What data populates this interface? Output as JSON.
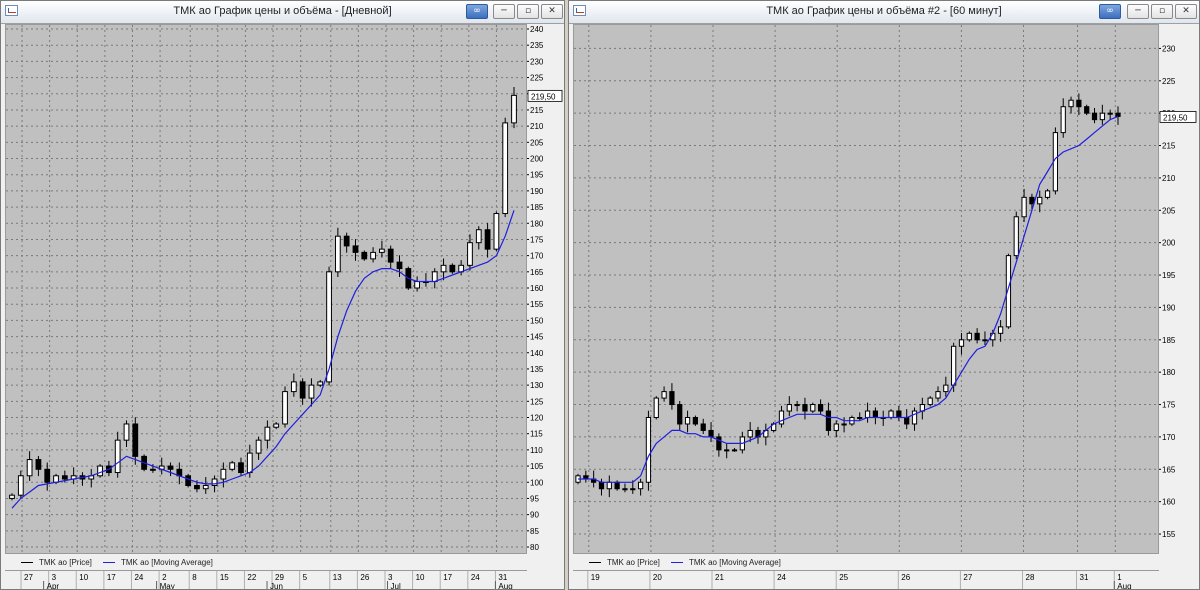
{
  "windows": [
    {
      "title": "ТМК ао График цены и объёма - [Дневной]",
      "legend": [
        {
          "label": "TMK ao [Price]",
          "color": "#000000"
        },
        {
          "label": "TMK ao [Moving Average]",
          "color": "#1f1fe0"
        }
      ],
      "y_ticks": [
        240,
        235,
        230,
        225,
        220,
        215,
        210,
        205,
        200,
        195,
        190,
        185,
        180,
        175,
        170,
        165,
        160,
        155,
        150,
        145,
        140,
        135,
        130,
        125,
        120,
        115,
        110,
        105,
        100,
        95,
        90,
        85,
        80
      ],
      "last_price": "219,50",
      "x_day_labels": [
        "27",
        "3",
        "10",
        "17",
        "24",
        "2",
        "8",
        "15",
        "22",
        "29",
        "5",
        "13",
        "26",
        "3",
        "10",
        "17",
        "24",
        "31"
      ],
      "x_month_labels": [
        "Apr",
        "May",
        "Jun",
        "Jul",
        "Aug"
      ]
    },
    {
      "title": "ТМК ао График цены и объёма #2 - [60 минут]",
      "legend": [
        {
          "label": "TMK ao [Price]",
          "color": "#000000"
        },
        {
          "label": "TMK ao [Moving Average]",
          "color": "#1f1fe0"
        }
      ],
      "y_ticks": [
        230,
        225,
        220,
        215,
        210,
        205,
        200,
        195,
        190,
        185,
        180,
        175,
        170,
        165,
        160,
        155
      ],
      "last_price": "219,50",
      "x_day_labels": [
        "19",
        "20",
        "21",
        "24",
        "25",
        "26",
        "27",
        "28",
        "31",
        "1"
      ],
      "x_month_labels": [
        "Aug"
      ]
    }
  ],
  "chart_data": [
    {
      "type": "line",
      "title": "ТМК ао График цены и объёма - [Дневной]",
      "series": [
        {
          "name": "TMK ao [Price]",
          "values": [
            96,
            102,
            107,
            104,
            100,
            102,
            101,
            102,
            101,
            102,
            105,
            103,
            113,
            118,
            108,
            104,
            104,
            105,
            104,
            102,
            99,
            98,
            99,
            101,
            104,
            106,
            103,
            109,
            113,
            117,
            118,
            128,
            131,
            126,
            130,
            131,
            165,
            176,
            173,
            171,
            169,
            171,
            172,
            168,
            166,
            160,
            162,
            162,
            165,
            167,
            165,
            167,
            174,
            178,
            172,
            183,
            211,
            219.5
          ]
        },
        {
          "name": "TMK ao [Moving Average]",
          "values": [
            92,
            95,
            97,
            99,
            99.5,
            100,
            100.5,
            101,
            101.5,
            102,
            103,
            104,
            106,
            108,
            107,
            106,
            105,
            104,
            103,
            102,
            101,
            100,
            99.5,
            99.5,
            100,
            101,
            102,
            103,
            105,
            108,
            111,
            115,
            118,
            121,
            124,
            127,
            135,
            145,
            153,
            159,
            163,
            165,
            166,
            166,
            165,
            163,
            162,
            162,
            162,
            163,
            164,
            165,
            166,
            167,
            168,
            170,
            176,
            184
          ]
        }
      ],
      "ylim": [
        80,
        240
      ]
    },
    {
      "type": "line",
      "title": "ТМК ао График цены и объёма #2 - [60 минут]",
      "series": [
        {
          "name": "TMK ao [Price]",
          "values": [
            164,
            163.5,
            163,
            162,
            163,
            162,
            162,
            162,
            163,
            173,
            176,
            177,
            175,
            172,
            173,
            172,
            171,
            170,
            168,
            168,
            168,
            170,
            171,
            170,
            171,
            172,
            174,
            175,
            175,
            174,
            175,
            174,
            171,
            172,
            172,
            173,
            173,
            174,
            173,
            173,
            174,
            173,
            172,
            174,
            175,
            176,
            177,
            178,
            184,
            185,
            186,
            185,
            185,
            186,
            187,
            198,
            204,
            207,
            206,
            207,
            208,
            217,
            221,
            222,
            221,
            220,
            219,
            220,
            220,
            219.5
          ]
        },
        {
          "name": "TMK ao [Moving Average]",
          "values": [
            163.5,
            163.5,
            163.5,
            163,
            163,
            163,
            163,
            163,
            164,
            167,
            169,
            170,
            171,
            171,
            170.5,
            170.5,
            170,
            170,
            169.5,
            169,
            169,
            169,
            169.5,
            170,
            171,
            172,
            172.5,
            173,
            173.5,
            173.5,
            173.5,
            173.5,
            173,
            173,
            172.5,
            172.5,
            172.5,
            173,
            173,
            173,
            173,
            173,
            173,
            173.5,
            174,
            174.5,
            175,
            176,
            178,
            180,
            182,
            183.5,
            184,
            186,
            189,
            193,
            197,
            201,
            205,
            209,
            211,
            213,
            214,
            214.5,
            215,
            216,
            217,
            218,
            219,
            219.5
          ]
        }
      ],
      "ylim": [
        153,
        233
      ]
    }
  ]
}
